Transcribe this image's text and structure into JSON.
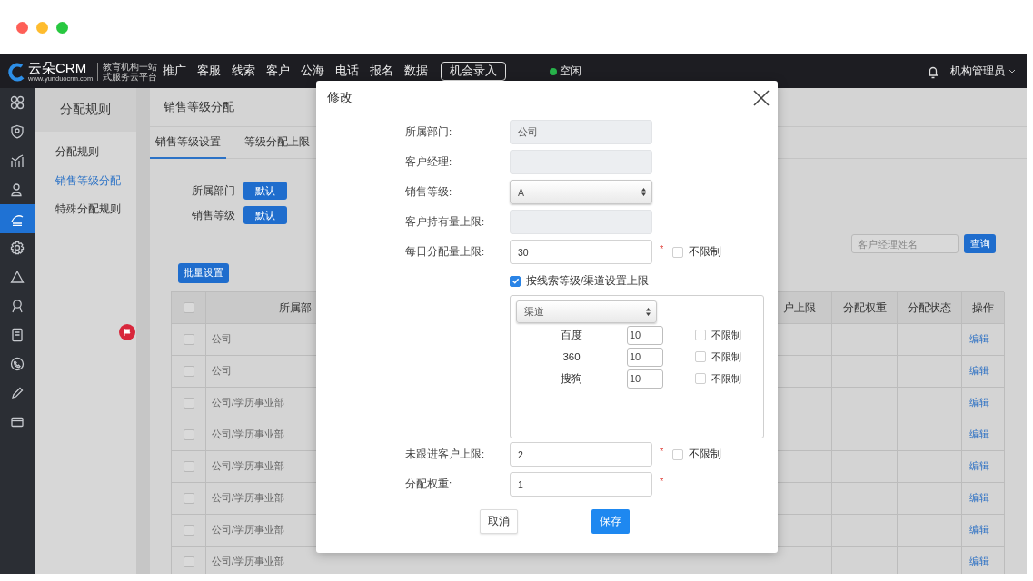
{
  "nav": {
    "brand": "云朵CRM",
    "brand_url": "www.yunduocrm.com",
    "tagline": [
      "教育机构一站",
      "式服务云平台"
    ],
    "menu": [
      "推广",
      "客服",
      "线索",
      "客户",
      "公海",
      "电话",
      "报名",
      "数据"
    ],
    "entry_button": "机会录入",
    "status": "空闲",
    "user": "机构管理员"
  },
  "rail": [
    {
      "selected": false
    },
    {
      "selected": false
    },
    {
      "selected": false
    },
    {
      "selected": false
    },
    {
      "selected": true
    },
    {
      "selected": false
    },
    {
      "selected": false
    },
    {
      "selected": false
    },
    {
      "selected": false
    },
    {
      "selected": false
    },
    {
      "selected": false
    },
    {
      "selected": false
    }
  ],
  "sidebar": {
    "title": "分配规则",
    "items": [
      {
        "label": "分配规则",
        "selected": false
      },
      {
        "label": "销售等级分配",
        "selected": true
      },
      {
        "label": "特殊分配规则",
        "selected": false
      }
    ]
  },
  "main": {
    "title": "销售等级分配",
    "tabs": [
      {
        "label": "销售等级设置",
        "selected": true
      },
      {
        "label": "等级分配上限",
        "selected": false
      }
    ],
    "filters": [
      {
        "label": "所属部门",
        "button": "默认"
      },
      {
        "label": "销售等级",
        "button": "默认"
      }
    ],
    "search": {
      "placeholder": "客户经理姓名",
      "button": "查询"
    },
    "batch_button": "批量设置",
    "table": {
      "columns": [
        {
          "kind": "checkbox",
          "checked": false
        },
        {
          "kind": "text",
          "label": "所属部"
        },
        {
          "kind": "text",
          "label": "户上限"
        },
        {
          "kind": "text",
          "label": "分配权重"
        },
        {
          "kind": "text",
          "label": "分配状态"
        },
        {
          "kind": "text",
          "label": "操作"
        }
      ],
      "rows": [
        {
          "checked": false,
          "department": "公司",
          "action": "编辑"
        },
        {
          "checked": false,
          "department": "公司",
          "action": "编辑"
        },
        {
          "checked": false,
          "department": "公司/学历事业部",
          "action": "编辑"
        },
        {
          "checked": false,
          "department": "公司/学历事业部",
          "action": "编辑"
        },
        {
          "checked": false,
          "department": "公司/学历事业部",
          "action": "编辑"
        },
        {
          "checked": false,
          "department": "公司/学历事业部",
          "action": "编辑"
        },
        {
          "checked": false,
          "department": "公司/学历事业部",
          "action": "编辑"
        },
        {
          "checked": false,
          "department": "公司/学历事业部",
          "action": "编辑"
        }
      ]
    }
  },
  "dialog": {
    "title": "修改",
    "fields": [
      {
        "kind": "text",
        "label": "所属部门:",
        "value": "公司",
        "disabled": true
      },
      {
        "kind": "text",
        "label": "客户经理:",
        "disabled": true
      },
      {
        "kind": "select",
        "label": "销售等级:",
        "value": "A"
      },
      {
        "kind": "text",
        "label": "客户持有量上限:",
        "disabled": true
      },
      {
        "kind": "text",
        "label": "每日分配量上限:",
        "value": "30",
        "disabled": false,
        "required_mark": "*",
        "unlimited": {
          "label": "不限制",
          "checked": false
        }
      },
      {
        "kind": "check",
        "label": "按线索等级/渠道设置上限",
        "checked": true
      },
      {
        "kind": "channels",
        "select": "渠道",
        "rows": [
          {
            "name": "百度",
            "value": "10",
            "unlimited": {
              "label": "不限制",
              "checked": false
            }
          },
          {
            "name": "360",
            "value": "10",
            "unlimited": {
              "label": "不限制",
              "checked": false
            }
          },
          {
            "name": "搜狗",
            "value": "10",
            "unlimited": {
              "label": "不限制",
              "checked": false
            }
          }
        ]
      },
      {
        "kind": "text",
        "label": "未跟进客户上限:",
        "value": "2",
        "disabled": false,
        "required_mark": "*",
        "unlimited": {
          "label": "不限制",
          "checked": false
        }
      },
      {
        "kind": "text",
        "label": "分配权重:",
        "value": "1",
        "disabled": false,
        "required_mark": "*"
      }
    ],
    "buttons": [
      {
        "kind": "default",
        "label": "取消"
      },
      {
        "kind": "primary",
        "label": "保存"
      }
    ]
  }
}
